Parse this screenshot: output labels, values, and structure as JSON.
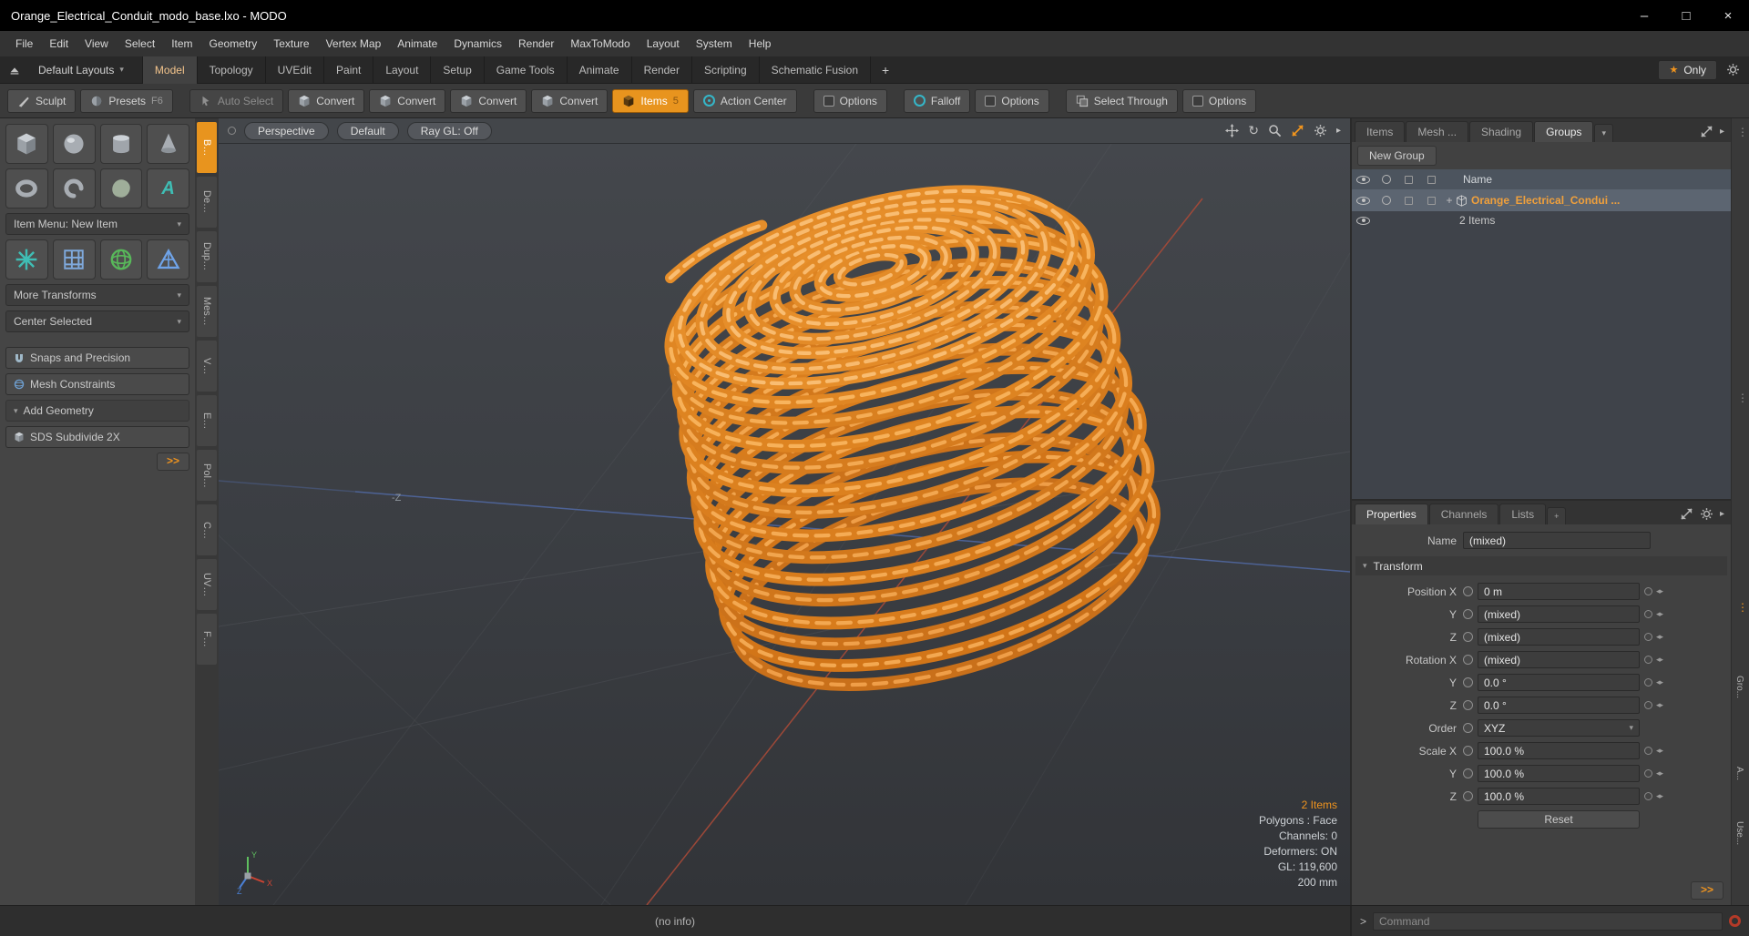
{
  "colors": {
    "accent": "#f0941e",
    "model_orange": "#d87c1c",
    "selection": "#5c6571"
  },
  "window": {
    "title": "Orange_Electrical_Conduit_modo_base.lxo - MODO",
    "minimize": "–",
    "maximize": "□",
    "close": "×"
  },
  "menu": {
    "items": [
      "File",
      "Edit",
      "View",
      "Select",
      "Item",
      "Geometry",
      "Texture",
      "Vertex Map",
      "Animate",
      "Dynamics",
      "Render",
      "MaxToModo",
      "Layout",
      "System",
      "Help"
    ]
  },
  "layout_bar": {
    "layouts": "Default Layouts",
    "tabs": [
      "Model",
      "Topology",
      "UVEdit",
      "Paint",
      "Layout",
      "Setup",
      "Game Tools",
      "Animate",
      "Render",
      "Scripting",
      "Schematic Fusion"
    ],
    "add": "+",
    "only": "Only"
  },
  "toolbar": {
    "sculpt": "Sculpt",
    "presets": "Presets",
    "presets_key": "F6",
    "auto_select": "Auto Select",
    "convert1": "Convert",
    "convert2": "Convert",
    "convert3": "Convert",
    "convert4": "Convert",
    "items": "Items",
    "items_key": "5",
    "action_center": "Action Center",
    "options1": "Options",
    "falloff": "Falloff",
    "options2": "Options",
    "select_through": "Select Through",
    "options3": "Options"
  },
  "left_panel": {
    "item_menu": "Item Menu: New Item",
    "more_transforms": "More Transforms",
    "center_selected": "Center Selected",
    "snaps": "Snaps and Precision",
    "mesh_constraints": "Mesh Constraints",
    "add_geometry": "Add Geometry",
    "sds": "SDS Subdivide 2X",
    "expand": ">>"
  },
  "left_strip": {
    "tabs": [
      "B…",
      "De…",
      "Dup…",
      "Mes…",
      "V…",
      "E…",
      "Pol…",
      "C…",
      "UV…",
      "F…"
    ]
  },
  "viewport": {
    "camera": "Perspective",
    "shading": "Default",
    "raygl": "Ray GL: Off",
    "neg_z": "-Z",
    "gizmo": {
      "x": "X",
      "y": "Y",
      "z": "Z"
    },
    "stats": [
      "2 Items",
      "Polygons : Face",
      "Channels: 0",
      "Deformers: ON",
      "GL: 119,600",
      "200 mm"
    ]
  },
  "groups_panel": {
    "tabs": [
      "Items",
      "Mesh ...",
      "Shading",
      "Groups"
    ],
    "new_group": "New Group",
    "name_header": "Name",
    "item_expander": "+",
    "item_name": "Orange_Electrical_Condui ...",
    "item_count": "2 Items"
  },
  "properties_panel": {
    "tabs": [
      "Properties",
      "Channels",
      "Lists"
    ],
    "add_tab": "+",
    "name_label": "Name",
    "name_value": "(mixed)",
    "section": "Transform",
    "rows": [
      {
        "label": "Position X",
        "value": "0 m"
      },
      {
        "label": "Y",
        "value": "(mixed)"
      },
      {
        "label": "Z",
        "value": "(mixed)"
      },
      {
        "label": "Rotation X",
        "value": "(mixed)"
      },
      {
        "label": "Y",
        "value": "0.0 °"
      },
      {
        "label": "Z",
        "value": "0.0 °"
      }
    ],
    "order_label": "Order",
    "order_value": "XYZ",
    "scale_rows": [
      {
        "label": "Scale X",
        "value": "100.0 %"
      },
      {
        "label": "Y",
        "value": "100.0 %"
      },
      {
        "label": "Z",
        "value": "100.0 %"
      }
    ],
    "reset": "Reset",
    "expand": ">>"
  },
  "right_gutter": {
    "tabs": [
      "Gro...",
      "A...",
      "Use..."
    ]
  },
  "status_bar": {
    "info": "(no info)"
  },
  "command_bar": {
    "prompt": ">",
    "placeholder": "Command"
  },
  "icons": {
    "caret_down": "▾",
    "play": "▸",
    "rotate": "↻",
    "star": "★",
    "vdots": "⋮",
    "spinner": "◂▸",
    "text_tool": "A"
  }
}
